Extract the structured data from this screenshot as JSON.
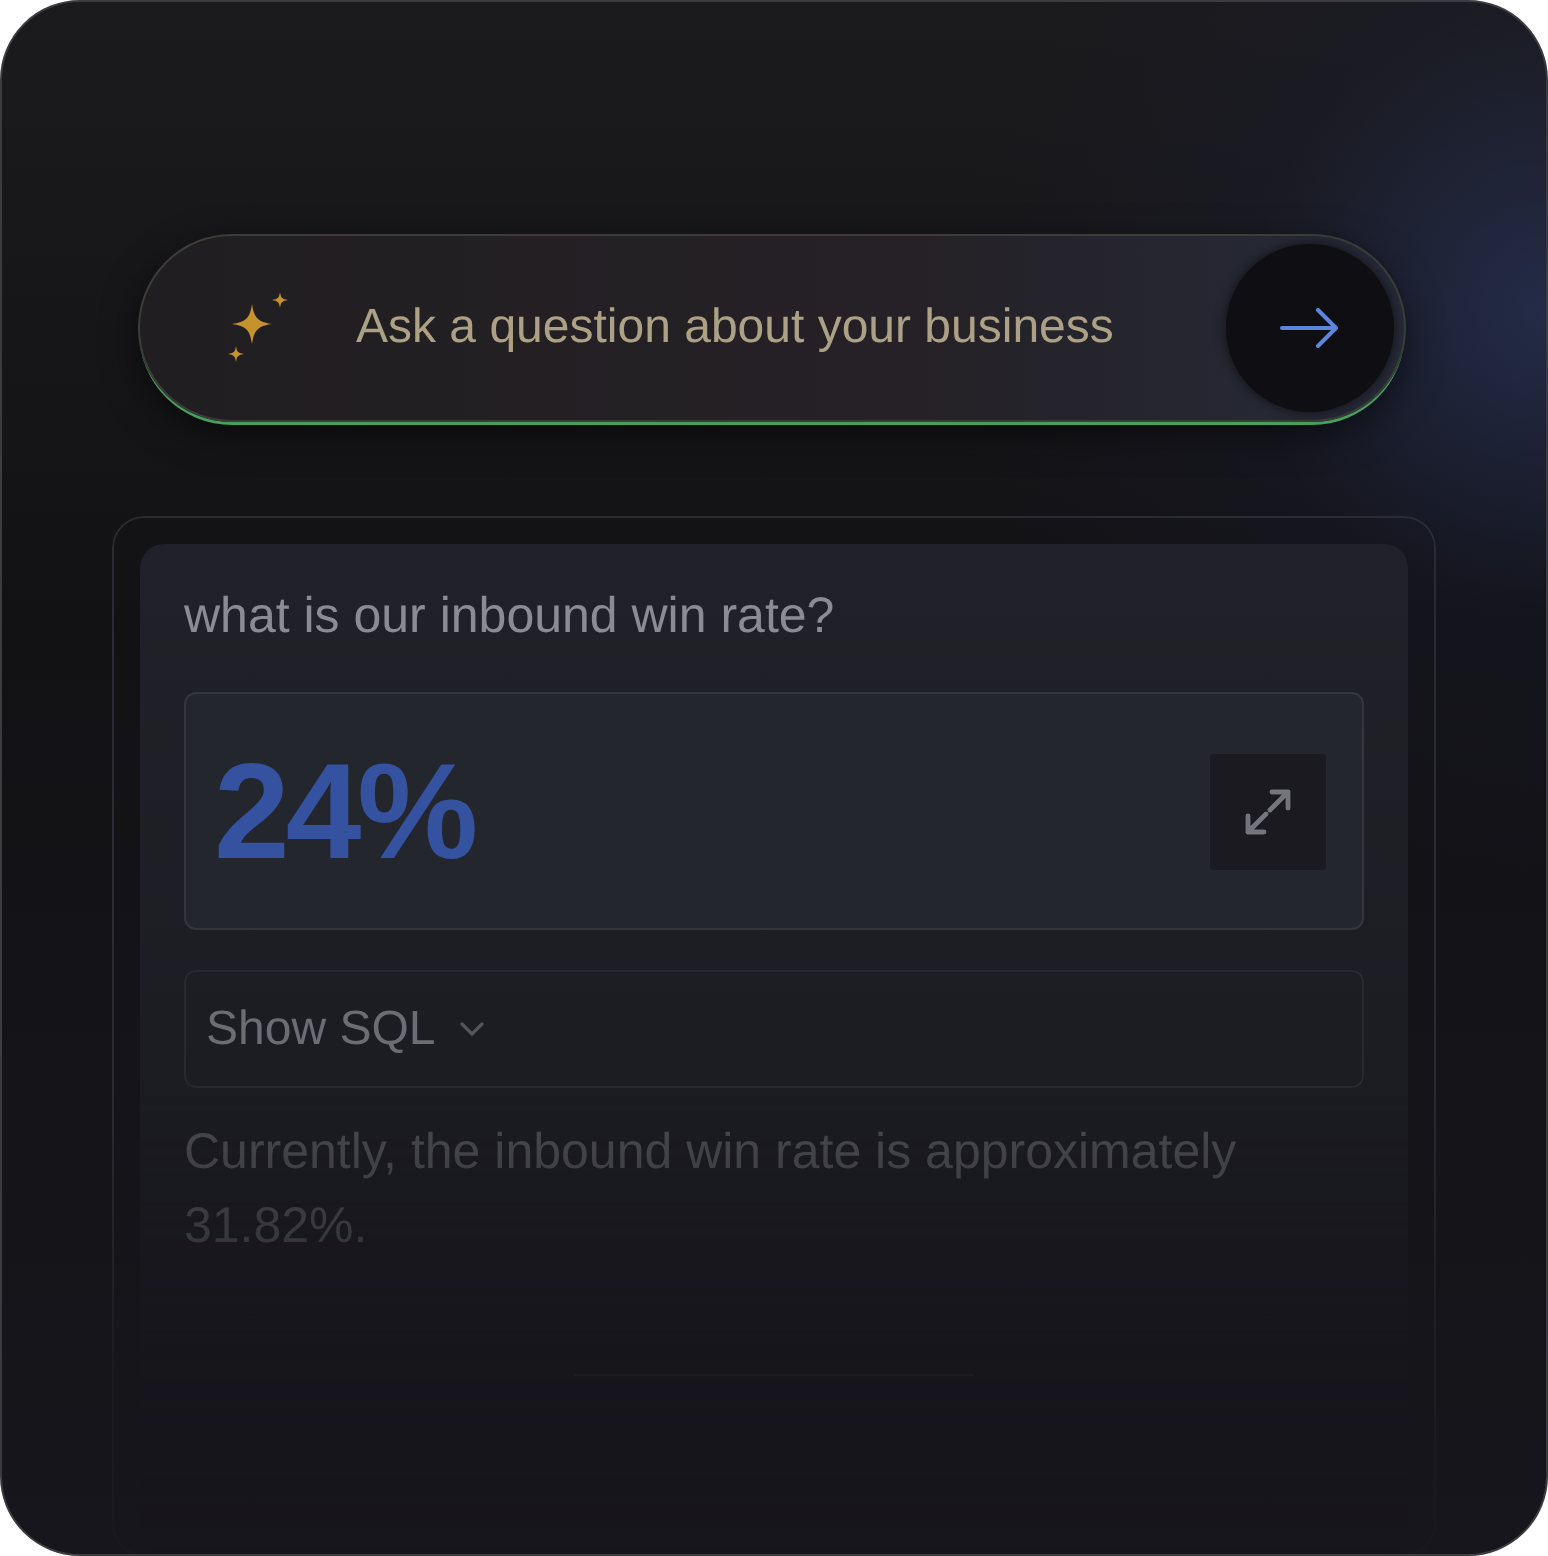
{
  "prompt_bar": {
    "placeholder": "Ask a question about your business"
  },
  "result_card": {
    "question": "what is our inbound win rate?",
    "metric": {
      "value": "24%"
    },
    "sql_toggle": {
      "label": "Show SQL",
      "expanded": false
    },
    "answer": "Currently, the inbound win rate is approximately 31.82%."
  }
}
